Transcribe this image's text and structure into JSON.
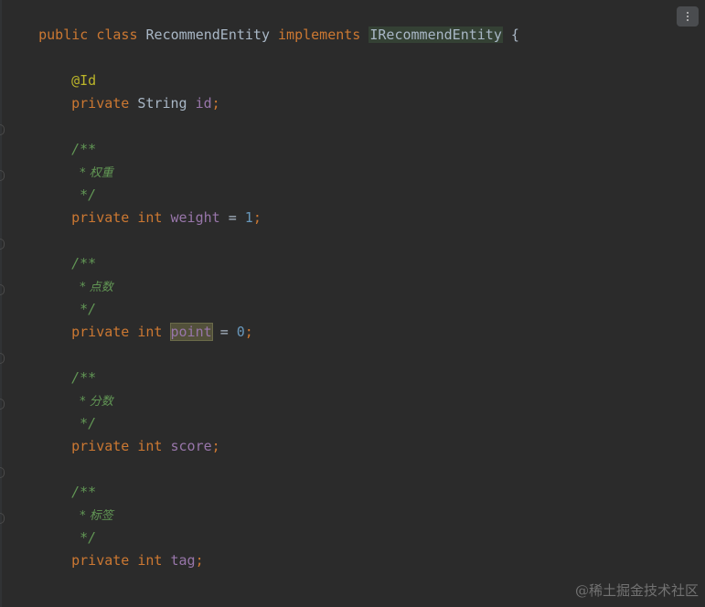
{
  "code": {
    "class_decl": {
      "kw_public": "public",
      "kw_class": "class",
      "class_name": "RecommendEntity",
      "kw_implements": "implements",
      "interface_name": "IRecommendEntity",
      "brace": "{"
    },
    "id_field": {
      "annotation": "@Id",
      "kw_private": "private",
      "type": "String",
      "name": "id",
      "semicolon": ";"
    },
    "weight_field": {
      "comment_open": "/**",
      "comment_text": "* 权重",
      "comment_close": "*/",
      "kw_private": "private",
      "type": "int",
      "name": "weight",
      "assign": "=",
      "value": "1",
      "semicolon": ";"
    },
    "point_field": {
      "comment_open": "/**",
      "comment_text": "* 点数",
      "comment_close": "*/",
      "kw_private": "private",
      "type": "int",
      "name": "point",
      "assign": "=",
      "value": "0",
      "semicolon": ";"
    },
    "score_field": {
      "comment_open": "/**",
      "comment_text": "* 分数",
      "comment_close": "*/",
      "kw_private": "private",
      "type": "int",
      "name": "score",
      "semicolon": ";"
    },
    "tag_field": {
      "comment_open": "/**",
      "comment_text": "* 标签",
      "comment_close": "*/",
      "kw_private": "private",
      "type": "int",
      "name": "tag",
      "semicolon": ";"
    }
  },
  "toolbar": {
    "menu_icon": "more-vertical-icon"
  },
  "watermark": "@稀土掘金技术社区",
  "colors": {
    "background": "#2b2b2b",
    "keyword": "#cc7832",
    "annotation": "#bbb529",
    "field": "#9876aa",
    "number": "#6897bb",
    "comment": "#629755",
    "text": "#a9b7c6"
  }
}
